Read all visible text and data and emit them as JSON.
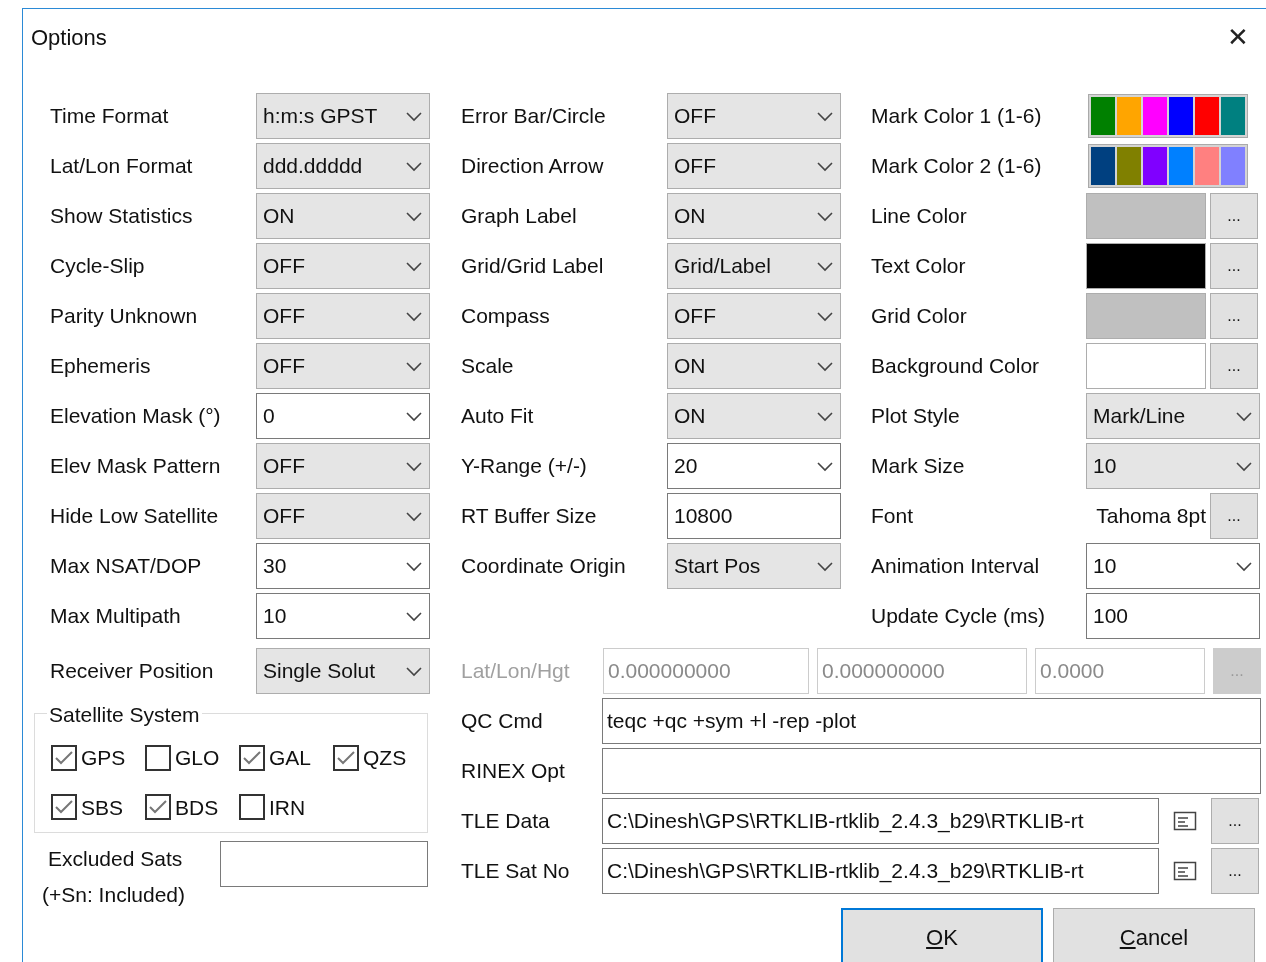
{
  "window": {
    "title": "Options",
    "close": "✕"
  },
  "columns": [
    [
      {
        "kind": "select",
        "label": "Time Format",
        "value": "h:m:s GPST"
      },
      {
        "kind": "select",
        "label": "Lat/Lon Format",
        "value": "ddd.ddddd"
      },
      {
        "kind": "select",
        "label": "Show Statistics",
        "value": "ON"
      },
      {
        "kind": "select",
        "label": "Cycle-Slip",
        "value": "OFF"
      },
      {
        "kind": "select",
        "label": "Parity Unknown",
        "value": "OFF"
      },
      {
        "kind": "select",
        "label": "Ephemeris",
        "value": "OFF"
      },
      {
        "kind": "combo",
        "label": "Elevation Mask (°)",
        "value": "0"
      },
      {
        "kind": "select",
        "label": "Elev Mask Pattern",
        "value": "OFF"
      },
      {
        "kind": "select",
        "label": "Hide Low Satellite",
        "value": "OFF"
      },
      {
        "kind": "combo",
        "label": "Max NSAT/DOP",
        "value": "30"
      },
      {
        "kind": "combo",
        "label": "Max Multipath",
        "value": "10"
      }
    ],
    [
      {
        "kind": "select",
        "label": "Error Bar/Circle",
        "value": "OFF"
      },
      {
        "kind": "select",
        "label": "Direction Arrow",
        "value": "OFF"
      },
      {
        "kind": "select",
        "label": "Graph Label",
        "value": "ON"
      },
      {
        "kind": "select",
        "label": "Grid/Grid Label",
        "value": "Grid/Label"
      },
      {
        "kind": "select",
        "label": "Compass",
        "value": "OFF"
      },
      {
        "kind": "select",
        "label": "Scale",
        "value": "ON"
      },
      {
        "kind": "select",
        "label": "Auto Fit",
        "value": "ON"
      },
      {
        "kind": "combo",
        "label": "Y-Range (+/-)",
        "value": "20"
      },
      {
        "kind": "input",
        "label": "RT Buffer Size",
        "value": "10800"
      },
      {
        "kind": "select",
        "label": "Coordinate Origin",
        "value": "Start Pos"
      }
    ],
    [
      {
        "kind": "palette",
        "label": "Mark Color 1 (1-6)",
        "colors": [
          {
            "color": "#008000"
          },
          {
            "color": "#ffa500"
          },
          {
            "color": "#ff00ff"
          },
          {
            "color": "#0000ff"
          },
          {
            "color": "#ff0000"
          },
          {
            "color": "#008080"
          }
        ]
      },
      {
        "kind": "palette",
        "label": "Mark Color 2 (1-6)",
        "colors": [
          {
            "color": "#004080"
          },
          {
            "color": "#808000"
          },
          {
            "color": "#8000ff"
          },
          {
            "color": "#0080ff"
          },
          {
            "color": "#ff8080"
          },
          {
            "color": "#8080ff"
          }
        ]
      },
      {
        "kind": "color",
        "label": "Line Color",
        "color": "#c0c0c0",
        "button": "..."
      },
      {
        "kind": "color",
        "label": "Text Color",
        "color": "#000000",
        "button": "..."
      },
      {
        "kind": "color",
        "label": "Grid Color",
        "color": "#c0c0c0",
        "button": "..."
      },
      {
        "kind": "color",
        "label": "Background Color",
        "color": "#ffffff",
        "button": "..."
      },
      {
        "kind": "select",
        "label": "Plot Style",
        "value": "Mark/Line"
      },
      {
        "kind": "select",
        "label": "Mark Size",
        "value": "10"
      },
      {
        "kind": "font",
        "label": "Font",
        "value": "Tahoma 8pt",
        "button": "..."
      },
      {
        "kind": "combo",
        "label": "Animation Interval",
        "value": "10"
      },
      {
        "kind": "input",
        "label": "Update Cycle (ms)",
        "value": "100"
      }
    ]
  ],
  "receiver_position": {
    "label": "Receiver Position",
    "value": "Single Solut"
  },
  "satellite_system": {
    "title": "Satellite System",
    "items": [
      {
        "label": "GPS",
        "checked": true
      },
      {
        "label": "GLO",
        "checked": false
      },
      {
        "label": "GAL",
        "checked": true
      },
      {
        "label": "QZS",
        "checked": true
      },
      {
        "label": "SBS",
        "checked": true
      },
      {
        "label": "BDS",
        "checked": true
      },
      {
        "label": "IRN",
        "checked": false
      }
    ]
  },
  "excluded_sats": {
    "label": "Excluded Sats",
    "note": "(+Sn: Included)"
  },
  "lat_lon_hgt": {
    "label": "Lat/Lon/Hgt",
    "disabled": true,
    "values": [
      "0.000000000",
      "0.000000000",
      "0.0000"
    ],
    "button": "..."
  },
  "fields": [
    {
      "label": "QC Cmd",
      "value": "teqc +qc +sym +l -rep -plot"
    },
    {
      "label": "RINEX Opt"
    },
    {
      "label": "TLE Data",
      "value": "C:\\Dinesh\\GPS\\RTKLIB-rtklib_2.4.3_b29\\RTKLIB-rt",
      "view": true,
      "button": "..."
    },
    {
      "label": "TLE Sat No",
      "value": "C:\\Dinesh\\GPS\\RTKLIB-rtklib_2.4.3_b29\\RTKLIB-rt",
      "view": true,
      "button": "..."
    }
  ],
  "buttons": [
    {
      "label": "OK",
      "default": true,
      "mnemonic_first": true
    },
    {
      "label": "Cancel",
      "default": false,
      "mnemonic_first": true
    }
  ]
}
